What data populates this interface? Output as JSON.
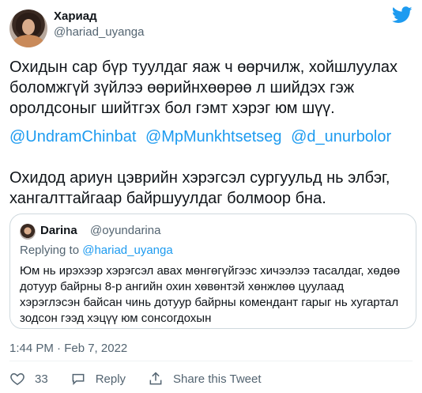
{
  "author": {
    "name": "Хариад",
    "handle": "@hariad_uyanga"
  },
  "tweet": {
    "paragraph1": "Охидын сар бүр туулдаг яаж ч өөрчилж, хойшлуулах боломжгүй зүйлээ өөрийнхөөрөө л шийдэх гэж оролдсоныг шийтгэх бол гэмт хэрэг юм шүү.",
    "mentions": [
      "@UndramChinbat",
      "@MpMunkhtsetseg",
      "@d_unurbolor"
    ],
    "paragraph3": "Охидод ариун цэврийн хэрэгсэл сургуульд нь элбэг, хангалттайгаар байршуулдаг болмоор бна."
  },
  "quoted": {
    "name": "Darina",
    "handle": "@oyundarina",
    "replying_prefix": "Replying to",
    "replying_handle": "@hariad_uyanga",
    "text": "Юм нь ирэхээр хэрэгсэл авах мөнгөгүйгээс хичээлээ тасалдаг, хөдөө дотуур байрны 8-р ангийн охин хөвөнтэй хөнжлөө цуулаад хэрэглэсэн байсан чинь дотуур байрны комендант гарыг нь хугартал зодсон гээд хэцүү юм сонсогдохын"
  },
  "timestamp": "1:44 PM · Feb 7, 2022",
  "actions": {
    "like_count": "33",
    "reply_label": "Reply",
    "share_label": "Share this Tweet"
  },
  "icons": {
    "brand": "twitter-bird-icon",
    "like": "heart-icon",
    "reply": "speech-bubble-icon",
    "share": "share-upload-icon"
  },
  "colors": {
    "brand": "#1d9bf0",
    "text": "#0f1419",
    "secondary": "#536471",
    "border": "#cfd9de"
  }
}
